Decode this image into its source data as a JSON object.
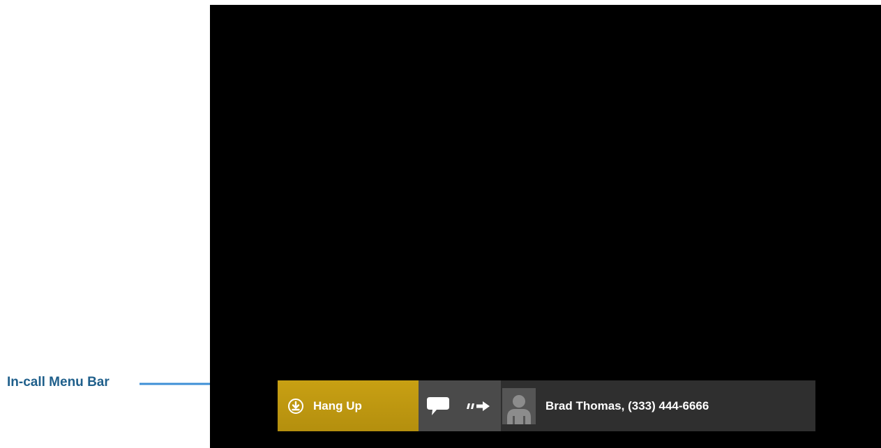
{
  "callout": {
    "label": "In-call Menu Bar",
    "color": "#1f5f8b",
    "arrow_color": "#3d8fd6"
  },
  "video": {
    "background": "#000000"
  },
  "menu_bar": {
    "hangup": {
      "label": "Hang Up",
      "icon": "hang-up-icon",
      "color": "#c19a12"
    },
    "tools": [
      {
        "name": "chat",
        "icon": "chat-bubble-icon"
      },
      {
        "name": "transfer",
        "icon": "transfer-arrow-icon"
      }
    ],
    "contact": {
      "avatar_icon": "person-silhouette-icon",
      "label": "Brad Thomas, (333) 444-6666"
    }
  }
}
